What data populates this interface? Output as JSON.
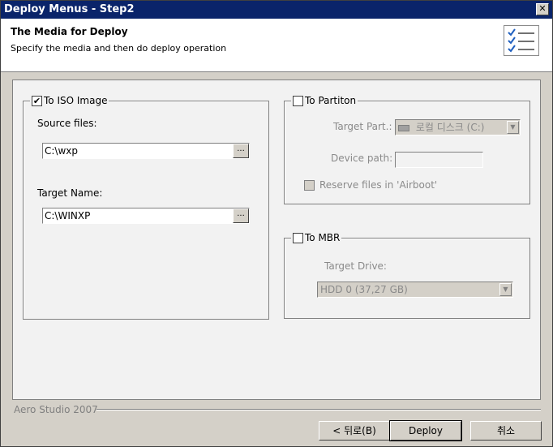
{
  "window": {
    "title": "Deploy Menus - Step2",
    "close_glyph": "✕"
  },
  "header": {
    "title": "The Media for Deploy",
    "subtitle": "Specify the media and then do deploy operation",
    "icon": "checklist-icon"
  },
  "iso": {
    "label": "To ISO Image",
    "checked": true,
    "source_label": "Source files:",
    "source_value": "C:\\wxp",
    "target_label": "Target Name:",
    "target_value": "C:\\WINXP",
    "browse_label": "..."
  },
  "partition": {
    "label": "To Partiton",
    "checked": false,
    "target_part_label": "Target Part.:",
    "target_part_value": "로컬 디스크 (C:)",
    "device_path_label": "Device path:",
    "device_path_value": "",
    "reserve_label": "Reserve files in 'Airboot'"
  },
  "mbr": {
    "label": "To MBR",
    "checked": false,
    "target_drive_label": "Target Drive:",
    "target_drive_value": "HDD 0 (37,27 GB)"
  },
  "footer": {
    "brand": "Aero Studio 2007",
    "back_label": "< 뒤로(B)",
    "deploy_label": "Deploy",
    "cancel_label": "취소"
  },
  "colors": {
    "titlebar": "#0a246a",
    "face": "#d4d0c8",
    "panel": "#f2f2f2"
  }
}
